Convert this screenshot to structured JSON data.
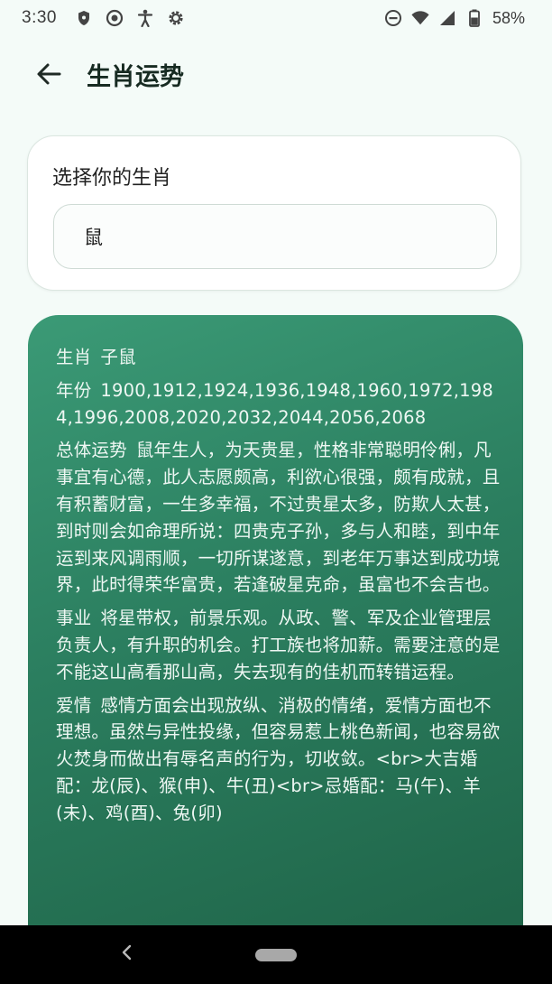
{
  "status_bar": {
    "time": "3:30",
    "battery": "58%",
    "icons_left": [
      "shield-icon",
      "record-icon",
      "accessibility-icon",
      "settings-icon"
    ],
    "icons_right": [
      "dnd-icon",
      "wifi-icon",
      "signal-icon",
      "battery-icon"
    ]
  },
  "app_bar": {
    "title": "生肖运势",
    "back_icon": "arrow-back-icon"
  },
  "selector": {
    "label": "选择你的生肖",
    "value": "鼠"
  },
  "result": {
    "zodiac": {
      "label": "生肖",
      "value": "子鼠"
    },
    "years": {
      "label": "年份",
      "value": "1900,1912,1924,1936,1948,1960,1972,1984,1996,2008,2020,2032,2044,2056,2068"
    },
    "overall": {
      "label": "总体运势",
      "value": "鼠年生人，为天贵星，性格非常聪明伶俐，凡事宜有心德，此人志愿颇高，利欲心很强，颇有成就，且有积蓄财富，一生多幸福，不过贵星太多，防欺人太甚，到时则会如命理所说：四贵克子孙，多与人和睦，到中年运到来风调雨顺，一切所谋遂意，到老年万事达到成功境界，此时得荣华富贵，若逢破星克命，虽富也不会吉也。"
    },
    "career": {
      "label": "事业",
      "value": "将星带权，前景乐观。从政、警、军及企业管理层负责人，有升职的机会。打工族也将加薪。需要注意的是不能这山高看那山高，失去现有的佳机而转错运程。"
    },
    "love": {
      "label": "爱情",
      "value": "感情方面会出现放纵、消极的情绪，爱情方面也不理想。虽然与异性投缘，但容易惹上桃色新闻，也容易欲火焚身而做出有辱名声的行为，切收敛。<br>大吉婚配：龙(辰)、猴(申)、牛(丑)<br>忌婚配：马(午)、羊(未)、鸡(酉)、兔(卯)"
    }
  },
  "nav_bar": {
    "back_icon": "nav-back-icon",
    "home_icon": "nav-home-pill"
  },
  "colors": {
    "background": "#f4fbf8",
    "card_gradient_start": "#3b9a76",
    "card_gradient_end": "#1f6448",
    "card_text": "#eef7f3"
  }
}
